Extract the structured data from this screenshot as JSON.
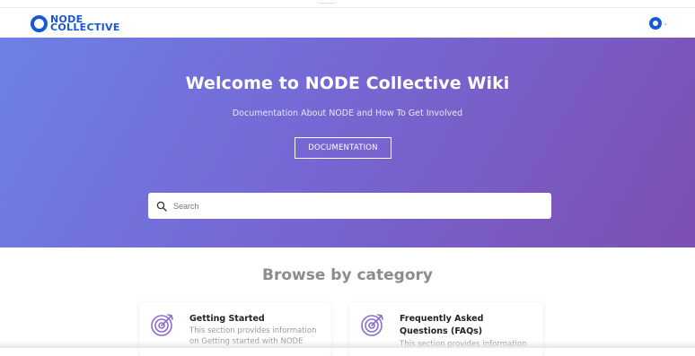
{
  "header": {
    "logo_line1": "NODE",
    "logo_line2": "COLLECTIVE"
  },
  "hero": {
    "title": "Welcome to NODE Collective Wiki",
    "subtitle": "Documentation About NODE and How To Get Involved",
    "documentation_button": "DOCUMENTATION"
  },
  "search": {
    "placeholder": "Search",
    "value": ""
  },
  "browse": {
    "title": "Browse by category",
    "cards": [
      {
        "icon": "target-icon",
        "title": "Getting Started",
        "description": "This section provides information on Getting started with NODE"
      },
      {
        "icon": "target-icon",
        "title": "Frequently Asked Questions (FAQs)",
        "description": "This section provides information"
      }
    ]
  },
  "colors": {
    "brand_blue": "#1658d8",
    "hero_gradient_start": "#6d80e6",
    "hero_gradient_end": "#7c4fb1",
    "icon_purple": "#8a6ccf"
  }
}
